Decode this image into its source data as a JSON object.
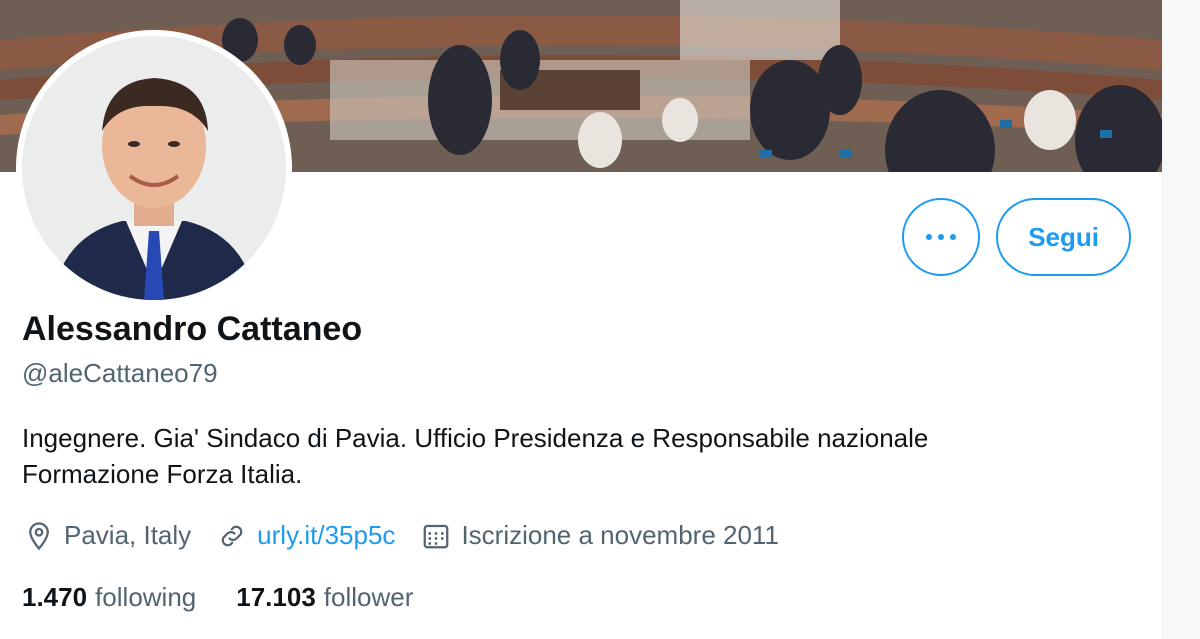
{
  "profile": {
    "name": "Alessandro Cattaneo",
    "handle": "@aleCattaneo79",
    "bio_line1": "Ingegnere. Gia' Sindaco di Pavia. Ufficio Presidenza e Responsabile nazionale",
    "bio_line2": "Formazione Forza Italia.",
    "location": "Pavia, Italy",
    "website": "urly.it/35p5c",
    "joined": "Iscrizione a novembre 2011"
  },
  "actions": {
    "follow_label": "Segui"
  },
  "stats": {
    "following_count": "1.470",
    "following_label": "following",
    "followers_count": "17.103",
    "followers_label": "follower"
  },
  "icons": {
    "more": "more-icon",
    "location": "location-pin-icon",
    "website": "link-icon",
    "joined": "calendar-icon"
  },
  "colors": {
    "accent": "#1d9bf0",
    "secondary_text": "#536471",
    "primary_text": "#0f1419"
  }
}
